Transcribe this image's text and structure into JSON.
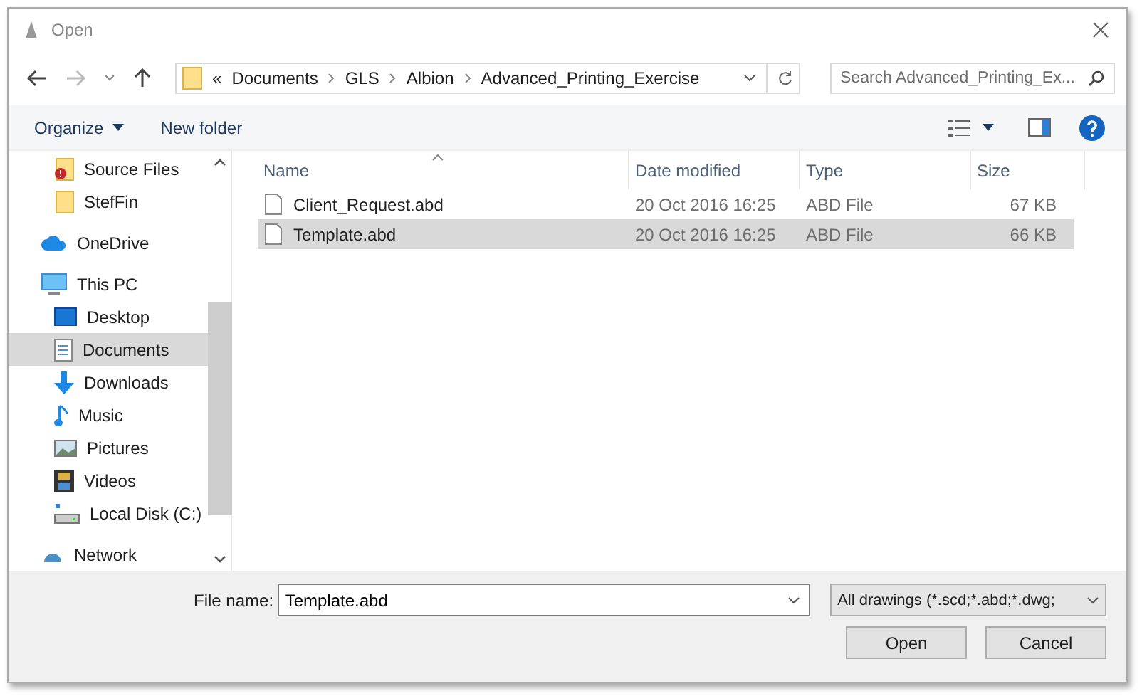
{
  "window": {
    "title": "Open"
  },
  "address": {
    "crumbs": [
      "«",
      "Documents",
      "GLS",
      "Albion",
      "Advanced_Printing_Exercise"
    ],
    "search_placeholder": "Search Advanced_Printing_Ex..."
  },
  "toolbar": {
    "organize": "Organize",
    "new_folder": "New folder"
  },
  "nav": {
    "pinned": [
      {
        "label": "Source Files",
        "kind": "folder-alert",
        "selected": false
      },
      {
        "label": "StefFin",
        "kind": "folder",
        "selected": false
      }
    ],
    "items": [
      {
        "label": "OneDrive",
        "kind": "cloud",
        "selected": false
      },
      {
        "label": "This PC",
        "kind": "pc",
        "selected": false,
        "children": [
          {
            "label": "Desktop",
            "kind": "desktop",
            "selected": false
          },
          {
            "label": "Documents",
            "kind": "documents",
            "selected": true
          },
          {
            "label": "Downloads",
            "kind": "downloads",
            "selected": false
          },
          {
            "label": "Music",
            "kind": "music",
            "selected": false
          },
          {
            "label": "Pictures",
            "kind": "pictures",
            "selected": false
          },
          {
            "label": "Videos",
            "kind": "videos",
            "selected": false
          },
          {
            "label": "Local Disk (C:)",
            "kind": "disk",
            "selected": false
          }
        ]
      },
      {
        "label": "Network",
        "kind": "network",
        "selected": false
      }
    ]
  },
  "table": {
    "columns": [
      "Name",
      "Date modified",
      "Type",
      "Size"
    ],
    "rows": [
      {
        "name": "Client_Request.abd",
        "date": "20 Oct 2016 16:25",
        "type": "ABD File",
        "size": "67 KB",
        "selected": false
      },
      {
        "name": "Template.abd",
        "date": "20 Oct 2016 16:25",
        "type": "ABD File",
        "size": "66 KB",
        "selected": true
      }
    ]
  },
  "footer": {
    "file_name_label": "File name:",
    "file_name": "Template.abd",
    "filter": "All drawings (*.scd;*.abd;*.dwg;",
    "buttons": [
      "Open",
      "Cancel"
    ]
  }
}
